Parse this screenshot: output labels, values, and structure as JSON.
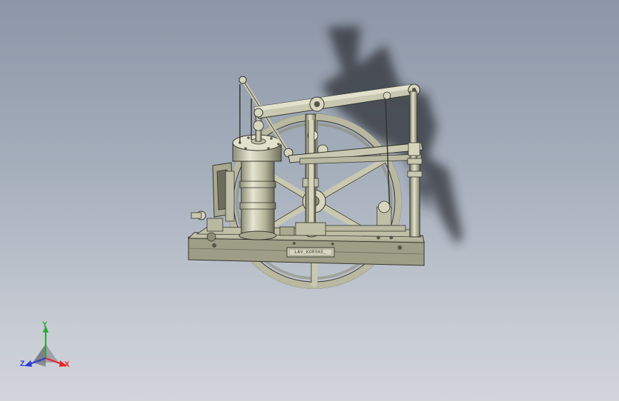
{
  "viewport": {
    "background_top": "#8c96a6",
    "background_bottom": "#d2d5da",
    "model": "beam-engine-assembly"
  },
  "model_colors": {
    "metal": "#c3c2a8",
    "metal_light": "#e2e1cc",
    "metal_dark": "#6e6d5c",
    "edge": "#33342c",
    "shadow": "#2e3138"
  },
  "nameplate": {
    "text": "LAV_KORSKE_"
  },
  "triad": {
    "x_label": "X",
    "y_label": "Y",
    "z_label": "Z",
    "x_color": "#e8262a",
    "y_color": "#2ea83a",
    "z_color": "#2c3fd6"
  }
}
